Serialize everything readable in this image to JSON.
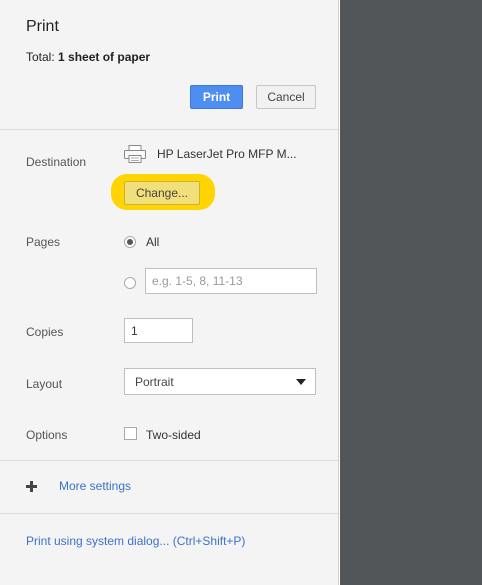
{
  "header": {
    "title": "Print",
    "total_label": "Total:",
    "total_value": "1 sheet of paper",
    "print_label": "Print",
    "cancel_label": "Cancel"
  },
  "destination": {
    "label": "Destination",
    "printer_name": "HP LaserJet Pro MFP M...",
    "change_label": "Change...",
    "icon": "printer-icon",
    "highlight_color": "#ffd400"
  },
  "pages": {
    "label": "Pages",
    "all_label": "All",
    "range_placeholder": "e.g. 1-5, 8, 11-13",
    "selected": "All"
  },
  "copies": {
    "label": "Copies",
    "value": "1"
  },
  "layout": {
    "label": "Layout",
    "selected": "Portrait"
  },
  "options": {
    "label": "Options",
    "two_sided_label": "Two-sided",
    "two_sided_checked": false
  },
  "more_settings": {
    "label": "More settings"
  },
  "system_dialog": {
    "label": "Print using system dialog... (Ctrl+Shift+P)"
  },
  "colors": {
    "accent": "#4d8ef0",
    "link": "#3b72c9",
    "preview_bg": "#525659"
  }
}
